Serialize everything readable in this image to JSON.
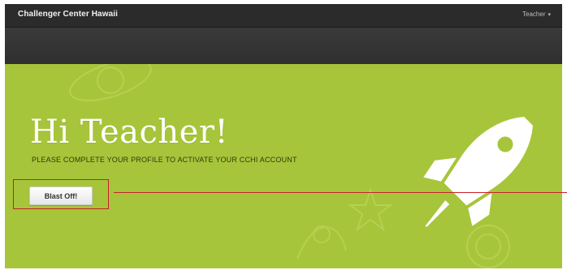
{
  "header": {
    "brand": "Challenger Center Hawaii",
    "user_menu_label": "Teacher",
    "user_menu_icon": "chevron-down-icon"
  },
  "hero": {
    "greeting": "Hi Teacher!",
    "subtitle": "PLEASE COMPLETE YOUR PROFILE TO ACTIVATE YOUR CCHI ACCOUNT",
    "cta_label": "Blast Off!",
    "decoration_icon": "rocket-icon"
  },
  "colors": {
    "topbar": "#2b2b2b",
    "subbar": "#353535",
    "hero_background": "#a7c53a",
    "annotation": "#c8202a"
  }
}
